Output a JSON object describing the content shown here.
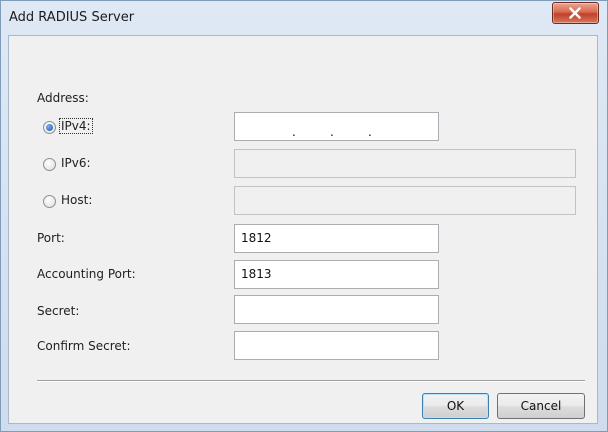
{
  "window": {
    "title": "Add RADIUS Server",
    "close_symbol": "X"
  },
  "address": {
    "heading": "Address:",
    "selected": "ipv4",
    "ipv4_label": "IPv4:",
    "ipv6_label": "IPv6:",
    "host_label": "Host:",
    "ipv4_separator": ".",
    "ipv4_value": "",
    "ipv6_value": "",
    "host_value": ""
  },
  "port": {
    "label": "Port:",
    "value": "1812"
  },
  "accounting_port": {
    "label": "Accounting Port:",
    "value": "1813"
  },
  "secret": {
    "label": "Secret:",
    "value": ""
  },
  "confirm_secret": {
    "label": "Confirm Secret:",
    "value": ""
  },
  "buttons": {
    "ok": "OK",
    "cancel": "Cancel"
  },
  "icons": {
    "close": "close-icon",
    "radio": "radio-button"
  },
  "colors": {
    "close_button": "#c2402a",
    "radio_selected": "#1a52a8",
    "default_button_border": "#3c7fb1"
  }
}
